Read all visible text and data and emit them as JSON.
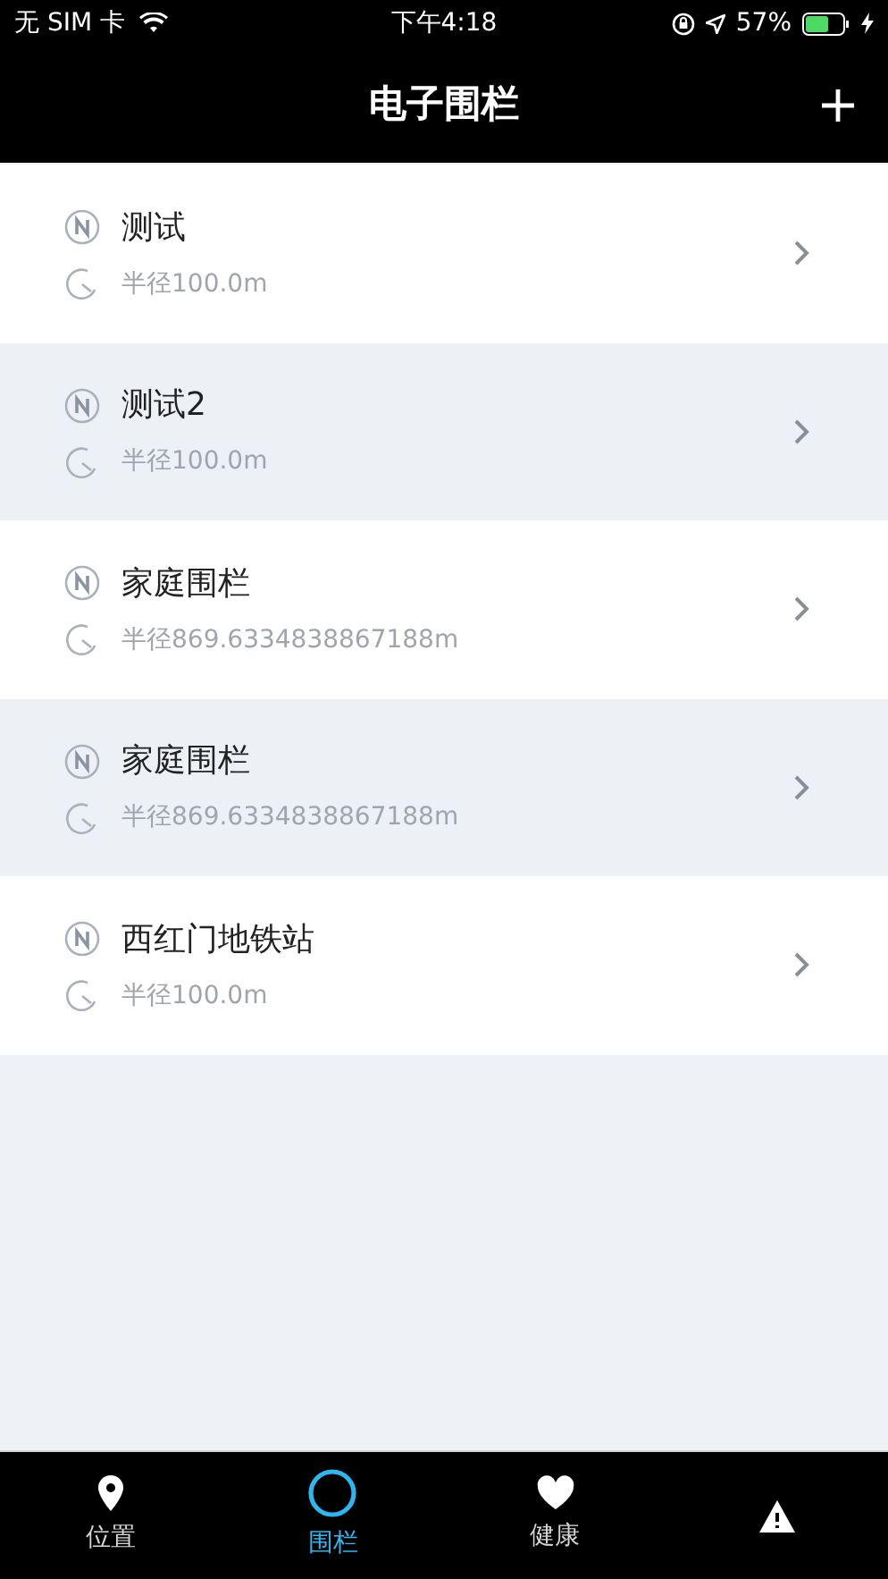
{
  "status_bar": {
    "carrier": "无 SIM 卡",
    "time": "下午4:18",
    "battery": "57%"
  },
  "nav": {
    "title": "电子围栏"
  },
  "fences": [
    {
      "name": "测试",
      "radius": "半径100.0m"
    },
    {
      "name": "测试2",
      "radius": "半径100.0m"
    },
    {
      "name": "家庭围栏",
      "radius": "半径869.6334838867188m"
    },
    {
      "name": "家庭围栏",
      "radius": "半径869.6334838867188m"
    },
    {
      "name": "西红门地铁站",
      "radius": "半径100.0m"
    }
  ],
  "tab_bar": [
    {
      "kind": "location",
      "label": "位置",
      "selected": false
    },
    {
      "kind": "fence",
      "label": "围栏",
      "selected": true
    },
    {
      "kind": "health",
      "label": "健康",
      "selected": false
    },
    {
      "kind": "alert",
      "selected": false
    }
  ]
}
